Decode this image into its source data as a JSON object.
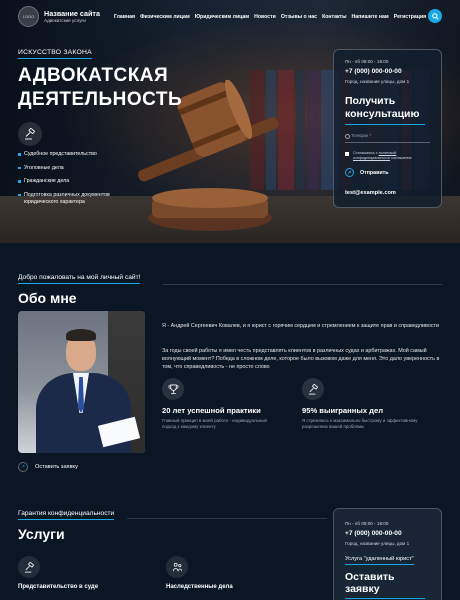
{
  "header": {
    "logo_text": "LOGO",
    "site_name": "Название сайта",
    "site_sub": "Адвокатские услуги",
    "nav": [
      "Главная",
      "Физическим лицам",
      "Юридическим лицам",
      "Новости",
      "Отзывы о нас",
      "Контакты",
      "Напишите нам",
      "Регистрация"
    ]
  },
  "hero": {
    "kicker": "ИСКУССТВО ЗАКОНА",
    "title_line1": "АДВОКАТСКАЯ",
    "title_line2": "ДЕЯТЕЛЬНОСТЬ",
    "services": [
      "Судебное представительство",
      "Уголовные дела",
      "Гражданские дела",
      "Подготовка различных документов юридического характера"
    ]
  },
  "consult_card": {
    "hours": "Пн - пб 08:00 - 18:00",
    "phone": "+7 (000) 000-00-00",
    "address": "Город, название улицы, дом 1",
    "title": "Получить консультацию",
    "phone_placeholder": "Телефон *",
    "consent_prefix": "Соглашаюсь с ",
    "consent_link": "политикой конфиденциальности",
    "consent_suffix": " соглашение",
    "send_label": "Отправить",
    "email": "test@example.com"
  },
  "about": {
    "kicker": "Добро пожаловать на мой личный сайт!",
    "title": "Обо мне",
    "p1": "Я - Андрей Сергеевич Ковалев, и я юрист с горячим сердцем и стремлением к защите прав и справедливости",
    "p2": "За годы своей работы я имел честь представлять клиентов в различных судах и арбитражах. Мой самый волнующий момент? Победа в сложном деле, которое было вызовом даже для меня. Это дало уверенность в том, что справедливость - не просто слово",
    "stat1_title": "20 лет успешной практики",
    "stat1_sub": "Главный принцип в моей работе - индивидуальный подход к каждому клиенту",
    "stat2_title": "95% выигранных дел",
    "stat2_sub": "Я стремлюсь к максимально быстрому и эффективному разрешению вашей проблемы",
    "order_label": "Оставить заявку"
  },
  "services": {
    "kicker": "Гарантия конфиденциальности",
    "title": "Услуги",
    "items": [
      "Представительство в суде",
      "Наследственные дела"
    ]
  },
  "card2": {
    "hours": "Пн - пб 08:00 - 18:00",
    "phone": "+7 (000) 000-00-00",
    "address": "Город, название улицы, дом 1",
    "service": "Услуга \"удаленный юрист\"",
    "cta": "Оставить заявку"
  },
  "colors": {
    "accent": "#1aa8e6",
    "background": "#0b1624"
  }
}
